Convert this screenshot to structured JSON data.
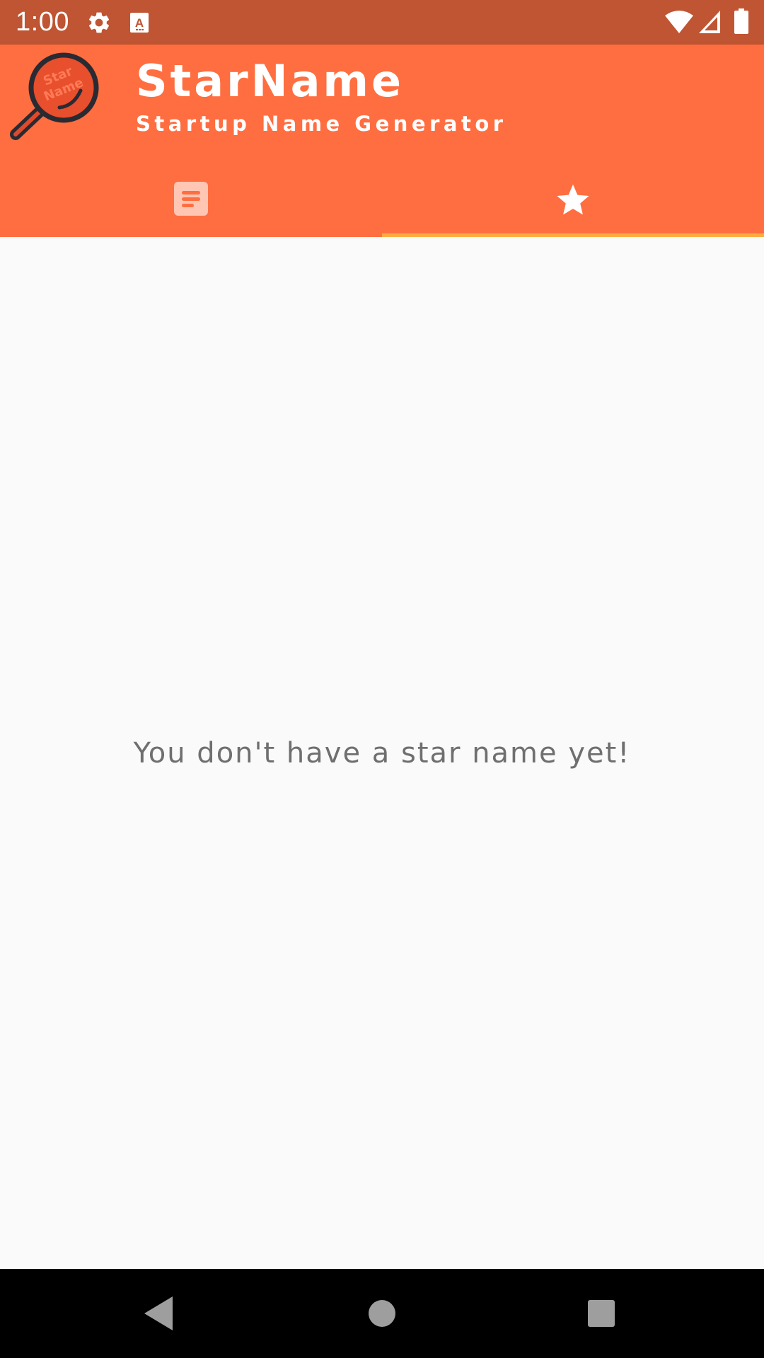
{
  "status_bar": {
    "time": "1:00",
    "icons": [
      "settings-icon",
      "keyboard-a-icon",
      "wifi-icon",
      "cell-signal-icon",
      "battery-icon"
    ],
    "background_color": "#bf5532"
  },
  "app_bar": {
    "title": "StarName",
    "subtitle": "Startup Name Generator",
    "logo_text": "Star Name",
    "background_color": "#ff6e40",
    "tabs": [
      {
        "label": "list",
        "icon": "list-icon",
        "selected": false
      },
      {
        "label": "favorites",
        "icon": "star-icon",
        "selected": true
      }
    ],
    "indicator_color": "#ffab40"
  },
  "main": {
    "empty_message": "You don't have a star name yet!"
  },
  "nav_bar": {
    "buttons": [
      "back-icon",
      "home-icon",
      "recents-icon"
    ]
  }
}
